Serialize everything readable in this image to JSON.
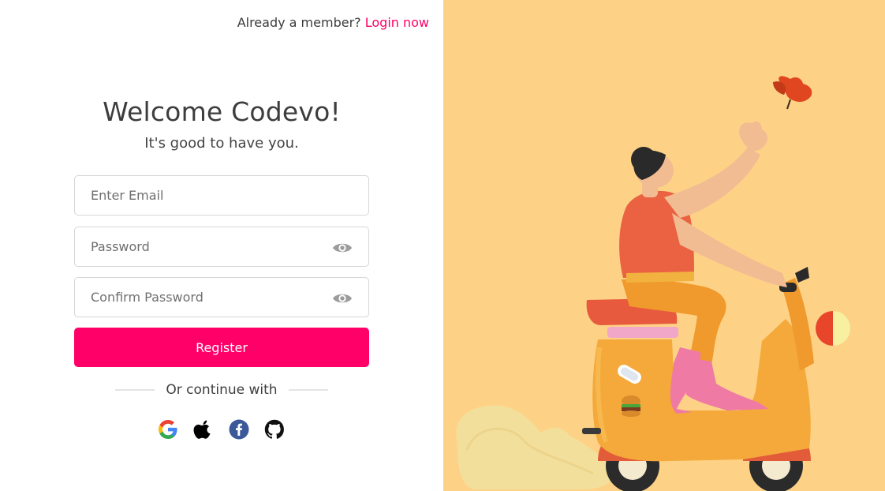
{
  "header": {
    "member_text": "Already a member?",
    "login_link": "Login now"
  },
  "form": {
    "title": "Welcome Codevo!",
    "subtitle": "It's good to have you.",
    "email_placeholder": "Enter Email",
    "password_placeholder": "Password",
    "confirm_placeholder": "Confirm Password",
    "register_label": "Register",
    "continue_text": "Or continue with"
  },
  "socials": [
    "google-icon",
    "apple-icon",
    "facebook-icon",
    "github-icon"
  ],
  "colors": {
    "accent": "#ff0069",
    "panel": "#fed286",
    "border": "#d6d6d6"
  }
}
